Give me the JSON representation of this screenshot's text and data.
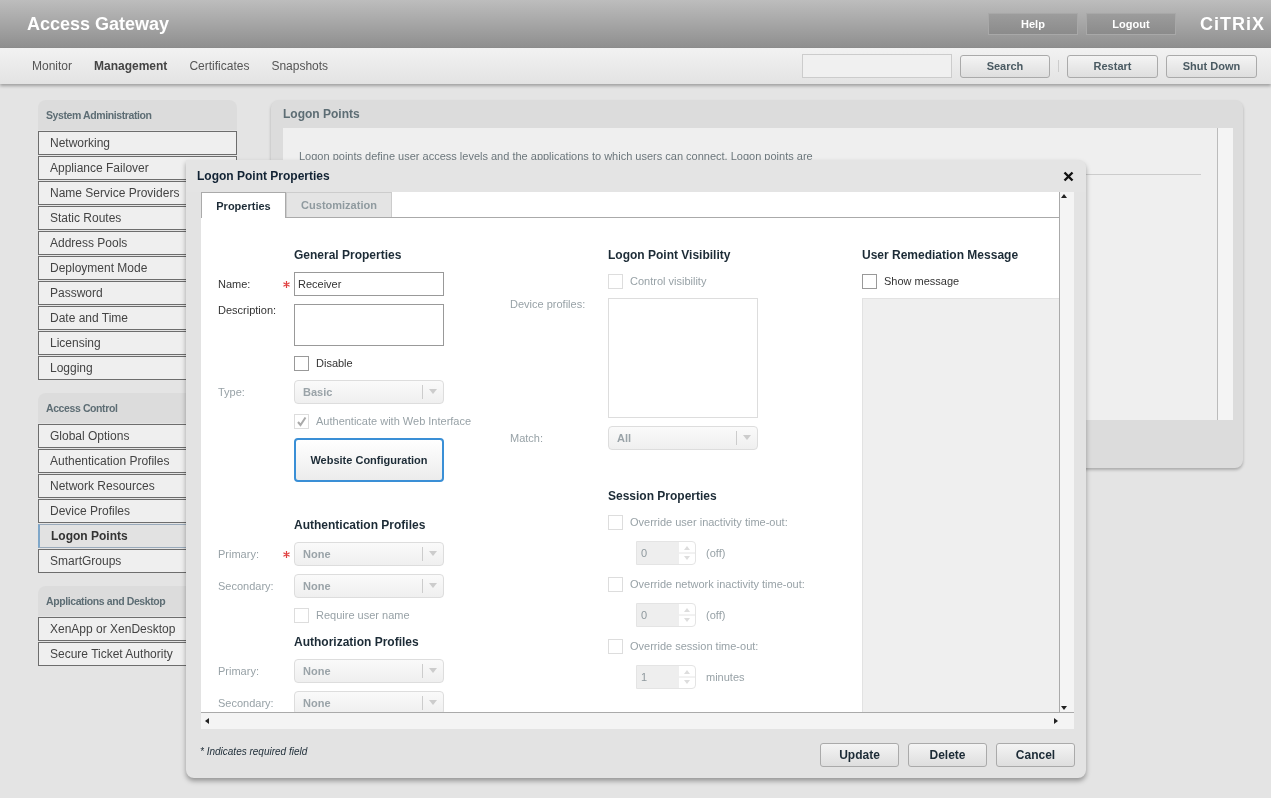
{
  "header": {
    "title": "Access Gateway",
    "buttons": [
      "Help",
      "Logout"
    ],
    "logo": "CiTRiX"
  },
  "nav": {
    "tabs": [
      {
        "label": "Monitor",
        "selected": false
      },
      {
        "label": "Management",
        "selected": true
      },
      {
        "label": "Certificates",
        "selected": false
      },
      {
        "label": "Snapshots",
        "selected": false
      }
    ],
    "search_button": "Search",
    "actions": [
      "Restart",
      "Shut Down"
    ]
  },
  "sidebar": {
    "sections": [
      {
        "title": "System Administration",
        "items": [
          {
            "label": "Networking",
            "selected": false
          },
          {
            "label": "Appliance Failover",
            "selected": false
          },
          {
            "label": "Name Service Providers",
            "selected": false
          },
          {
            "label": "Static Routes",
            "selected": false
          },
          {
            "label": "Address Pools",
            "selected": false
          },
          {
            "label": "Deployment Mode",
            "selected": false
          },
          {
            "label": "Password",
            "selected": false
          },
          {
            "label": "Date and Time",
            "selected": false
          },
          {
            "label": "Licensing",
            "selected": false
          },
          {
            "label": "Logging",
            "selected": false
          }
        ]
      },
      {
        "title": "Access Control",
        "items": [
          {
            "label": "Global Options",
            "selected": false
          },
          {
            "label": "Authentication Profiles",
            "selected": false
          },
          {
            "label": "Network Resources",
            "selected": false
          },
          {
            "label": "Device Profiles",
            "selected": false
          },
          {
            "label": "Logon Points",
            "selected": true
          },
          {
            "label": "SmartGroups",
            "selected": false
          }
        ]
      },
      {
        "title": "Applications and Desktop",
        "items": [
          {
            "label": "XenApp or XenDesktop",
            "selected": false
          },
          {
            "label": "Secure Ticket Authority",
            "selected": false
          }
        ]
      }
    ]
  },
  "panel": {
    "title": "Logon Points",
    "description": "Logon points define user access levels and the applications to which users can connect. Logon points are"
  },
  "dialog": {
    "title": "Logon Point Properties",
    "tabs": [
      {
        "label": "Properties",
        "selected": true
      },
      {
        "label": "Customization",
        "selected": false
      }
    ],
    "columns": [
      {
        "rows": [
          {
            "kind": "heading",
            "text": "General Properties"
          },
          {
            "kind": "text",
            "label": "Name:",
            "required": true,
            "value": "Receiver"
          },
          {
            "kind": "textarea",
            "label": "Description:"
          },
          {
            "kind": "checkbox",
            "label": "Disable",
            "checked": false,
            "disabled": false
          },
          {
            "kind": "select",
            "label": "Type:",
            "value": "Basic",
            "disabled": true
          },
          {
            "kind": "checkbox",
            "label": "Authenticate with Web Interface",
            "checked": true,
            "disabled": true
          },
          {
            "kind": "button",
            "label": "Website Configuration"
          },
          {
            "kind": "heading",
            "text": "Authentication Profiles"
          },
          {
            "kind": "select",
            "label": "Primary:",
            "value": "None",
            "required": true,
            "disabled": true
          },
          {
            "kind": "select",
            "label": "Secondary:",
            "value": "None",
            "disabled": true
          },
          {
            "kind": "checkbox",
            "label": "Require user name",
            "checked": false,
            "disabled": true
          },
          {
            "kind": "heading",
            "text": "Authorization Profiles"
          },
          {
            "kind": "select",
            "label": "Primary:",
            "value": "None",
            "disabled": true
          },
          {
            "kind": "select",
            "label": "Secondary:",
            "value": "None",
            "disabled": true
          }
        ]
      },
      {
        "rows": [
          {
            "kind": "heading",
            "text": "Logon Point Visibility"
          },
          {
            "kind": "checkbox",
            "label": "Control visibility",
            "checked": false,
            "disabled": true
          },
          {
            "kind": "listbox",
            "label": "Device profiles:",
            "disabled": true
          },
          {
            "kind": "select",
            "label": "Match:",
            "value": "All",
            "disabled": true
          },
          {
            "kind": "heading",
            "text": "Session Properties"
          },
          {
            "kind": "checkbox",
            "label": "Override user inactivity time-out:",
            "checked": false,
            "disabled": true
          },
          {
            "kind": "spinner",
            "value": "0",
            "unit": "(off)",
            "disabled": true
          },
          {
            "kind": "checkbox",
            "label": "Override network inactivity time-out:",
            "checked": false,
            "disabled": true
          },
          {
            "kind": "spinner",
            "value": "0",
            "unit": "(off)",
            "disabled": true
          },
          {
            "kind": "checkbox",
            "label": "Override session time-out:",
            "checked": false,
            "disabled": true
          },
          {
            "kind": "spinner",
            "value": "1",
            "unit": "minutes",
            "disabled": true
          }
        ]
      },
      {
        "rows": [
          {
            "kind": "heading",
            "text": "User Remediation Message"
          },
          {
            "kind": "checkbox",
            "label": "Show message",
            "checked": false,
            "disabled": false
          },
          {
            "kind": "message"
          }
        ]
      }
    ],
    "footnote": "* Indicates required field",
    "buttons": [
      "Update",
      "Delete",
      "Cancel"
    ]
  }
}
